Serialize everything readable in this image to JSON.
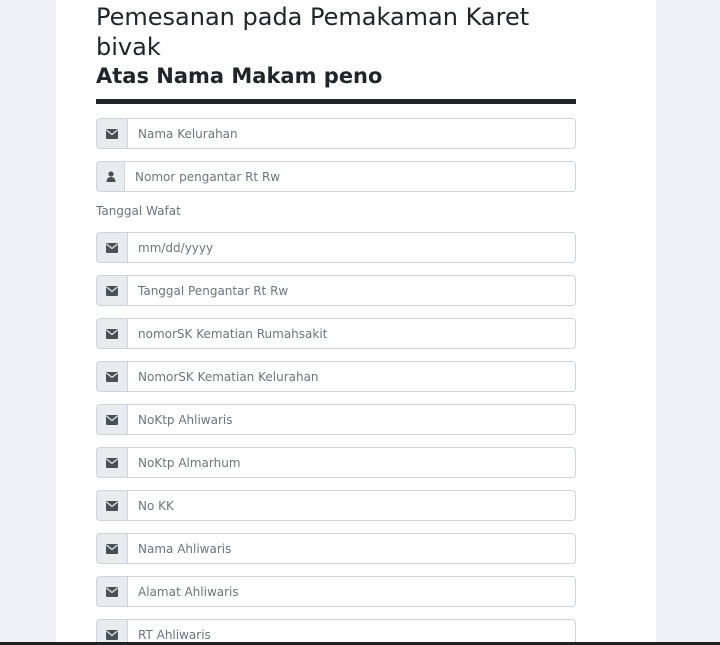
{
  "form": {
    "title": "Pemesanan pada Pemakaman Karet bivak",
    "subtitle": "Atas Nama Makam peno",
    "date_label": "Tanggal Wafat",
    "fields": [
      {
        "placeholder": "Nama Kelurahan",
        "icon": "envelope-icon"
      },
      {
        "placeholder": "Nomor pengantar Rt Rw",
        "icon": "user-icon"
      },
      {
        "placeholder": "mm/dd/yyyy",
        "icon": "envelope-icon"
      },
      {
        "placeholder": "Tanggal Pengantar Rt Rw",
        "icon": "envelope-icon"
      },
      {
        "placeholder": "nomorSK Kematian Rumahsakit",
        "icon": "envelope-icon"
      },
      {
        "placeholder": "NomorSK Kematian Kelurahan",
        "icon": "envelope-icon"
      },
      {
        "placeholder": "NoKtp Ahliwaris",
        "icon": "envelope-icon"
      },
      {
        "placeholder": "NoKtp Almarhum",
        "icon": "envelope-icon"
      },
      {
        "placeholder": "No KK",
        "icon": "envelope-icon"
      },
      {
        "placeholder": "Nama Ahliwaris",
        "icon": "envelope-icon"
      },
      {
        "placeholder": "Alamat Ahliwaris",
        "icon": "envelope-icon"
      },
      {
        "placeholder": "RT Ahliwaris",
        "icon": "envelope-icon"
      }
    ]
  }
}
